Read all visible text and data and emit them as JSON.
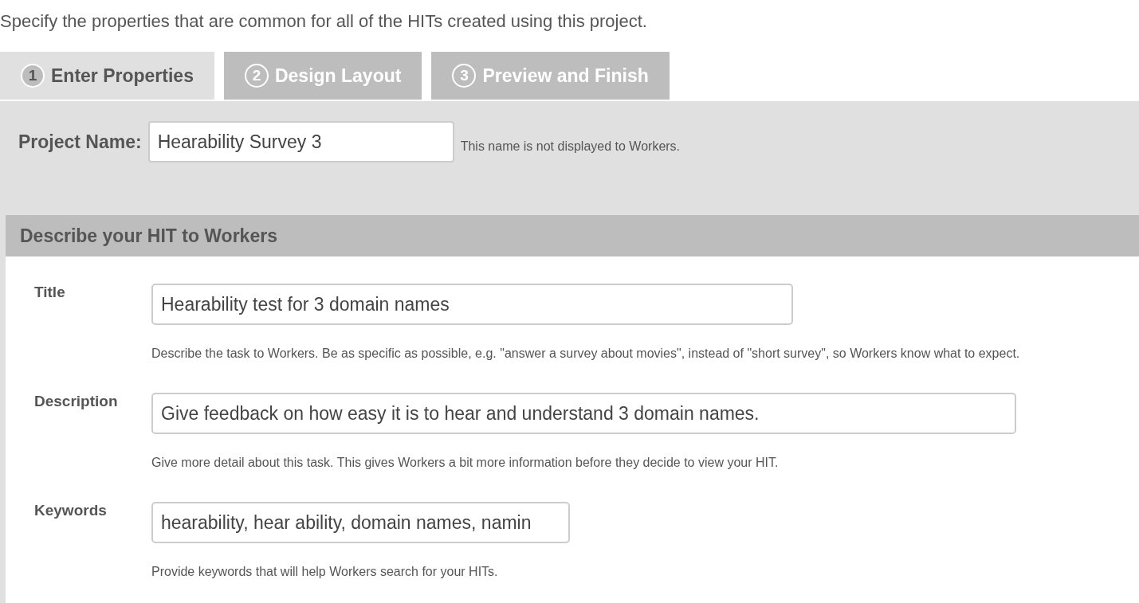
{
  "intro": "Specify the properties that are common for all of the HITs created using this project.",
  "tabs": [
    {
      "number": "1",
      "label": "Enter Properties",
      "selected": true
    },
    {
      "number": "2",
      "label": "Design Layout",
      "selected": false
    },
    {
      "number": "3",
      "label": "Preview and Finish",
      "selected": false
    }
  ],
  "project_name": {
    "label": "Project Name:",
    "value": "Hearability Survey 3",
    "hint": "This name is not displayed to Workers."
  },
  "section": {
    "title": "Describe your HIT to Workers",
    "fields": [
      {
        "label": "Title",
        "value": "Hearability test for 3 domain names",
        "help": "Describe the task to Workers. Be as specific as possible, e.g. \"answer a survey about movies\", instead of \"short survey\", so Workers know what to expect."
      },
      {
        "label": "Description",
        "value": "Give feedback on how easy it is to hear and understand 3 domain names.",
        "help": "Give more detail about this task. This gives Workers a bit more information before they decide to view your HIT."
      },
      {
        "label": "Keywords",
        "value": "hearability, hear ability, domain names, namin",
        "help": "Provide keywords that will help Workers search for your HITs."
      }
    ]
  }
}
